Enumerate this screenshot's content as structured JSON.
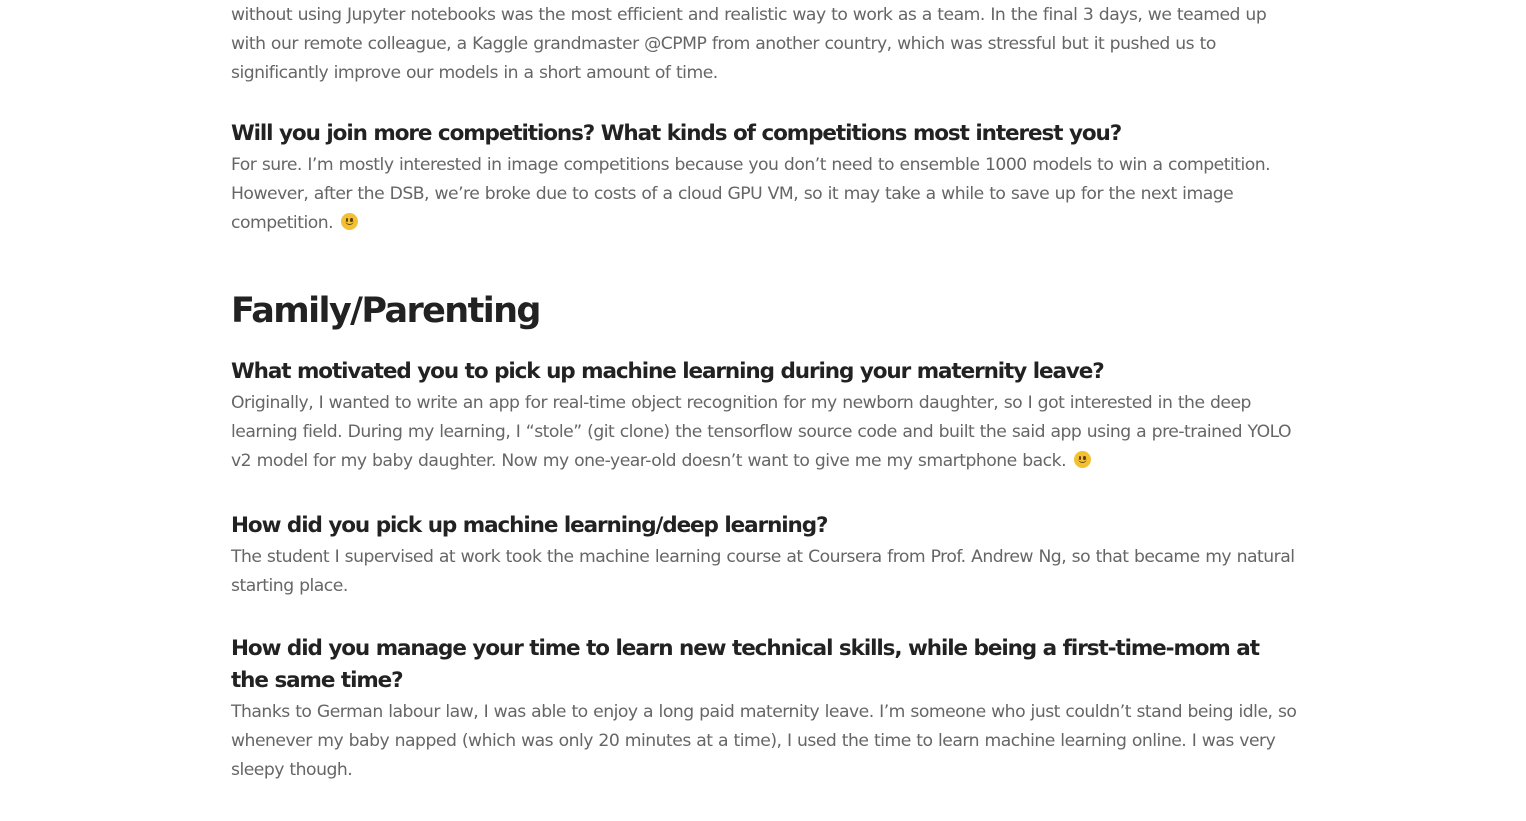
{
  "intro_paragraph": "without using Jupyter notebooks was the most efficient and realistic way to work as a team. In the final 3 days, we teamed up with our remote colleague, a Kaggle grandmaster @CPMP from another country, which was stressful but it pushed us to significantly improve our models in a short amount of time.",
  "competitions": {
    "question": "Will you join more competitions? What kinds of competitions most interest you?",
    "answer": "For sure. I’m mostly interested in image competitions because you don’t need to ensemble 1000 models to win a competition. However, after the DSB, we’re broke due to costs of a cloud GPU VM, so it may take a while to save up for the next image competition. "
  },
  "family_section": {
    "heading": "Family/Parenting",
    "qa": [
      {
        "question": "What motivated you to pick up machine learning during your maternity leave?",
        "answer": "Originally, I wanted to write an app for real-time object recognition for my newborn daughter, so I got interested in the deep learning field. During my learning, I “stole” (git clone) the tensorflow source code and built the said app using a pre-trained YOLO v2 model for my baby daughter. Now my one-year-old doesn’t want to give me my smartphone back. "
      },
      {
        "question": "How did you pick up machine learning/deep learning?",
        "answer": "The student I supervised at work took the machine learning course at Coursera from Prof. Andrew Ng, so that became my natural starting place."
      },
      {
        "question": "How did you manage your time to learn new technical skills, while being a first-time-mom at the same time?",
        "answer": "Thanks to German labour law, I was able to enjoy a long paid maternity leave. I’m someone who just couldn’t stand being idle, so whenever my baby napped (which was only 20 minutes at a time), I used the time to learn machine learning online. I was very sleepy though."
      }
    ]
  },
  "icons": {
    "smiley": "slightly-smiling-face-icon"
  },
  "colors": {
    "heading": "#222222",
    "body_text": "#666666",
    "emoji": "#f4c033"
  }
}
